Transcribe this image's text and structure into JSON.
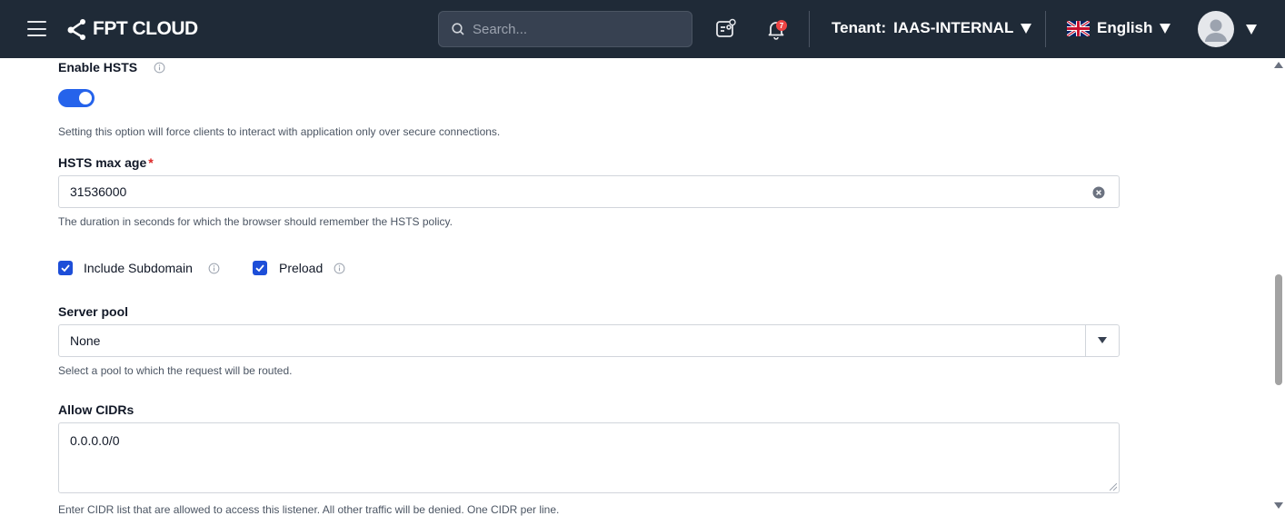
{
  "header": {
    "brand": "FPT CLOUD",
    "search_placeholder": "Search...",
    "notification_count": "7",
    "tenant_label": "Tenant:",
    "tenant_value": "IAAS-INTERNAL",
    "language": "English",
    "icons": [
      "menu-icon",
      "fpt-logo-icon",
      "search-icon",
      "user-card-icon",
      "bell-icon",
      "uk-flag-icon",
      "avatar-icon"
    ]
  },
  "form": {
    "hsts": {
      "label": "Enable HSTS",
      "enabled": true,
      "help": "Setting this option will force clients to interact with application only over secure connections."
    },
    "hsts_max_age": {
      "label": "HSTS max age",
      "required_mark": "*",
      "value": "31536000",
      "help": "The duration in seconds for which the browser should remember the HSTS policy."
    },
    "include_subdomain": {
      "label": "Include Subdomain",
      "checked": true
    },
    "preload": {
      "label": "Preload",
      "checked": true
    },
    "server_pool": {
      "label": "Server pool",
      "selected": "None",
      "help": "Select a pool to which the request will be routed."
    },
    "allow_cidrs": {
      "label": "Allow CIDRs",
      "value": "0.0.0.0/0",
      "help": "Enter CIDR list that are allowed to access this listener. All other traffic will be denied. One CIDR per line."
    }
  },
  "colors": {
    "topbar": "#1f2a37",
    "accent": "#2563eb",
    "required": "#dc2626"
  }
}
